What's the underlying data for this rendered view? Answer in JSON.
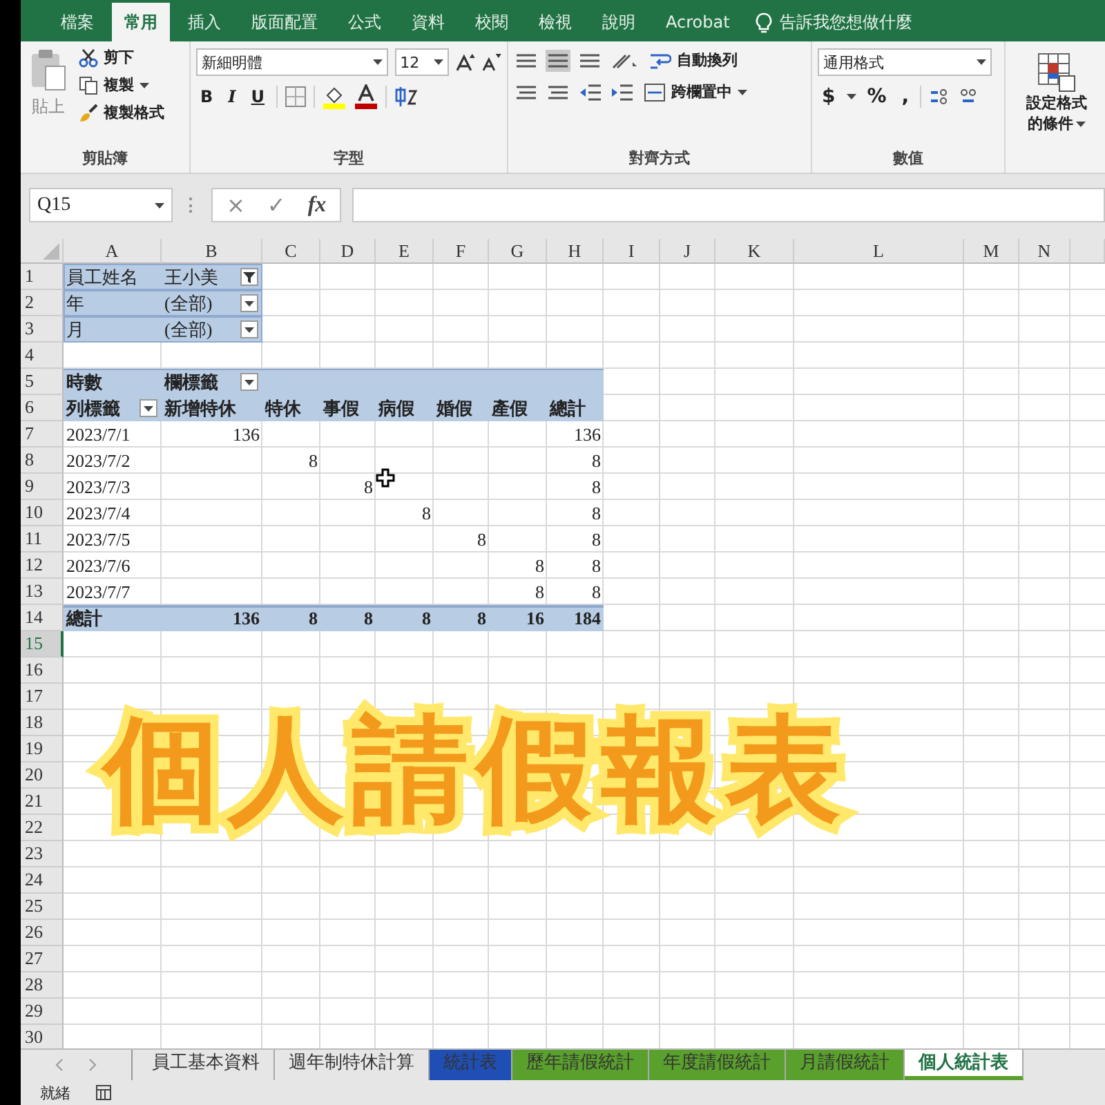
{
  "ribbon_tabs": [
    {
      "label": "檔案",
      "selected": false
    },
    {
      "label": "常用",
      "selected": true
    },
    {
      "label": "插入",
      "selected": false
    },
    {
      "label": "版面配置",
      "selected": false
    },
    {
      "label": "公式",
      "selected": false
    },
    {
      "label": "資料",
      "selected": false
    },
    {
      "label": "校閱",
      "selected": false
    },
    {
      "label": "檢視",
      "selected": false
    },
    {
      "label": "說明",
      "selected": false
    },
    {
      "label": "Acrobat",
      "selected": false
    }
  ],
  "tell_me": "告訴我您想做什麼",
  "clipboard": {
    "paste": "貼上",
    "cut": "剪下",
    "copy": "複製",
    "format_painter": "複製格式",
    "label": "剪貼簿"
  },
  "font": {
    "name": "新細明體",
    "size": "12",
    "bold": "B",
    "italic": "I",
    "underline": "U",
    "label": "字型"
  },
  "alignment": {
    "wrap": "自動換列",
    "merge": "跨欄置中",
    "label": "對齊方式"
  },
  "number": {
    "format": "通用格式",
    "currency": "$",
    "percent": "%",
    "comma": ",",
    "label": "數值"
  },
  "styles": {
    "conditional_line1": "設定格式",
    "conditional_line2": "的條件"
  },
  "formula_bar": {
    "name_box": "Q15",
    "cancel": "×",
    "enter": "✓",
    "function": "fx"
  },
  "columns": [
    "A",
    "B",
    "C",
    "D",
    "E",
    "F",
    "G",
    "H",
    "I",
    "J",
    "K",
    "L",
    "M",
    "N"
  ],
  "row_headers": [
    {
      "label": "1",
      "selected": false
    },
    {
      "label": "2",
      "selected": false
    },
    {
      "label": "3",
      "selected": false
    },
    {
      "label": "4",
      "selected": false
    },
    {
      "label": "5",
      "selected": false
    },
    {
      "label": "6",
      "selected": false
    },
    {
      "label": "7",
      "selected": false
    },
    {
      "label": "8",
      "selected": false
    },
    {
      "label": "9",
      "selected": false
    },
    {
      "label": "10",
      "selected": false
    },
    {
      "label": "11",
      "selected": false
    },
    {
      "label": "12",
      "selected": false
    },
    {
      "label": "13",
      "selected": false
    },
    {
      "label": "14",
      "selected": false
    },
    {
      "label": "15",
      "selected": true
    },
    {
      "label": "16",
      "selected": false
    },
    {
      "label": "17",
      "selected": false
    },
    {
      "label": "18",
      "selected": false
    },
    {
      "label": "19",
      "selected": false
    },
    {
      "label": "20",
      "selected": false
    },
    {
      "label": "21",
      "selected": false
    },
    {
      "label": "22",
      "selected": false
    },
    {
      "label": "23",
      "selected": false
    },
    {
      "label": "24",
      "selected": false
    },
    {
      "label": "25",
      "selected": false
    },
    {
      "label": "26",
      "selected": false
    },
    {
      "label": "27",
      "selected": false
    },
    {
      "label": "28",
      "selected": false
    },
    {
      "label": "29",
      "selected": false
    },
    {
      "label": "30",
      "selected": false
    }
  ],
  "pivot": {
    "filters": [
      {
        "field": "員工姓名",
        "value": "王小美",
        "filtered": true
      },
      {
        "field": "年",
        "value": "(全部)",
        "filtered": false
      },
      {
        "field": "月",
        "value": "(全部)",
        "filtered": false
      }
    ],
    "values_label": "時數",
    "columns_label": "欄標籤",
    "rows_label": "列標籤",
    "headers": [
      "新增特休",
      "特休",
      "事假",
      "病假",
      "婚假",
      "產假",
      "總計"
    ],
    "rows": [
      {
        "label": "2023/7/1",
        "cells": [
          "136",
          null,
          null,
          null,
          null,
          null,
          "136"
        ]
      },
      {
        "label": "2023/7/2",
        "cells": [
          null,
          "8",
          null,
          null,
          null,
          null,
          "8"
        ]
      },
      {
        "label": "2023/7/3",
        "cells": [
          null,
          null,
          "8",
          null,
          null,
          null,
          "8"
        ]
      },
      {
        "label": "2023/7/4",
        "cells": [
          null,
          null,
          null,
          "8",
          null,
          null,
          "8"
        ]
      },
      {
        "label": "2023/7/5",
        "cells": [
          null,
          null,
          null,
          null,
          "8",
          null,
          "8"
        ]
      },
      {
        "label": "2023/7/6",
        "cells": [
          null,
          null,
          null,
          null,
          null,
          "8",
          "8"
        ]
      },
      {
        "label": "2023/7/7",
        "cells": [
          null,
          null,
          null,
          null,
          null,
          "8",
          "8"
        ]
      }
    ],
    "total": {
      "label": "總計",
      "cells": [
        "136",
        "8",
        "8",
        "8",
        "8",
        "16",
        "184"
      ]
    }
  },
  "overlay_title": "個人請假報表",
  "sheet_tabs": [
    {
      "label": "員工基本資料",
      "selected": false
    },
    {
      "label": "週年制特休計算",
      "selected": false
    },
    {
      "label": "統計表",
      "selected": false,
      "color": "#1f4fb4"
    },
    {
      "label": "歷年請假統計",
      "selected": false,
      "color": "#5aa02c"
    },
    {
      "label": "年度請假統計",
      "selected": false,
      "color": "#5aa02c"
    },
    {
      "label": "月請假統計",
      "selected": false,
      "color": "#5aa02c"
    },
    {
      "label": "個人統計表",
      "selected": true,
      "color": "#5aa02c"
    }
  ],
  "status": "就緒"
}
